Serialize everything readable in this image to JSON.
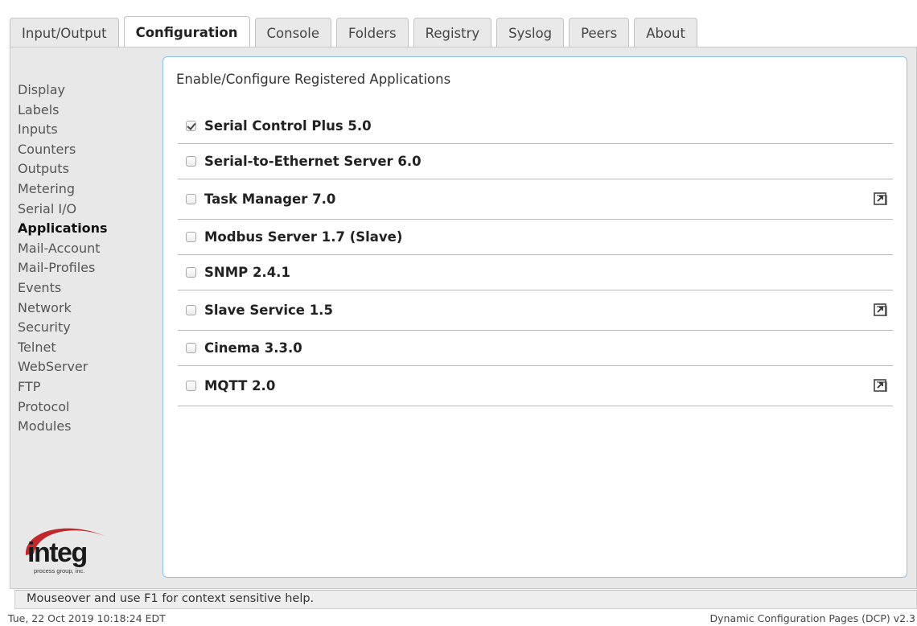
{
  "tabs": [
    {
      "label": "Input/Output",
      "active": false
    },
    {
      "label": "Configuration",
      "active": true
    },
    {
      "label": "Console",
      "active": false
    },
    {
      "label": "Folders",
      "active": false
    },
    {
      "label": "Registry",
      "active": false
    },
    {
      "label": "Syslog",
      "active": false
    },
    {
      "label": "Peers",
      "active": false
    },
    {
      "label": "About",
      "active": false
    }
  ],
  "sidebar": {
    "items": [
      {
        "label": "Display"
      },
      {
        "label": "Labels"
      },
      {
        "label": "Inputs"
      },
      {
        "label": "Counters"
      },
      {
        "label": "Outputs"
      },
      {
        "label": "Metering"
      },
      {
        "label": "Serial I/O"
      },
      {
        "label": "Applications",
        "active": true
      },
      {
        "label": "Mail-Account"
      },
      {
        "label": "Mail-Profiles"
      },
      {
        "label": "Events"
      },
      {
        "label": "Network"
      },
      {
        "label": "Security"
      },
      {
        "label": "Telnet"
      },
      {
        "label": "WebServer"
      },
      {
        "label": "FTP"
      },
      {
        "label": "Protocol"
      },
      {
        "label": "Modules"
      }
    ],
    "logo": {
      "word": "integ",
      "tagline": "process group, inc.",
      "accent": "#c0282d",
      "text_color": "#1a1a1a"
    }
  },
  "main": {
    "title": "Enable/Configure Registered Applications",
    "apps": [
      {
        "label": "Serial Control Plus 5.0",
        "checked": true,
        "external_link": false
      },
      {
        "label": "Serial-to-Ethernet Server 6.0",
        "checked": false,
        "external_link": false
      },
      {
        "label": "Task Manager 7.0",
        "checked": false,
        "external_link": true
      },
      {
        "label": "Modbus Server 1.7 (Slave)",
        "checked": false,
        "external_link": false
      },
      {
        "label": "SNMP 2.4.1",
        "checked": false,
        "external_link": false
      },
      {
        "label": "Slave Service 1.5",
        "checked": false,
        "external_link": true
      },
      {
        "label": "Cinema 3.3.0",
        "checked": false,
        "external_link": false
      },
      {
        "label": "MQTT 2.0",
        "checked": false,
        "external_link": true
      }
    ]
  },
  "help_text": "Mouseover and use F1 for context sensitive help.",
  "status": {
    "timestamp": "Tue, 22 Oct 2019 10:18:24 EDT",
    "version": "Dynamic Configuration Pages (DCP) v2.3"
  },
  "colors": {
    "panel_border": "#8fc1e3",
    "frame_bg": "#e8e8e8",
    "active_tab_bg": "#ffffff"
  }
}
